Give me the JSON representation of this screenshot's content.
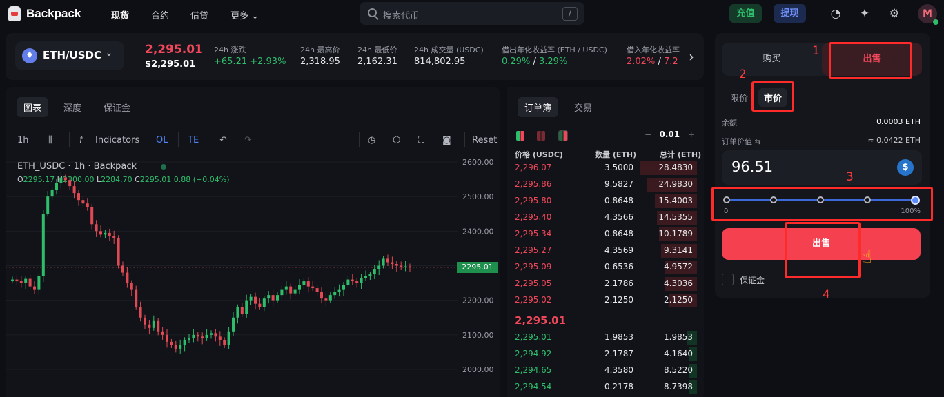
{
  "nav": {
    "logo": "Backpack",
    "items": [
      "现货",
      "合约",
      "借贷",
      "更多"
    ],
    "search_placeholder": "搜索代币",
    "search_shortcut": "/",
    "deposit": "充值",
    "withdraw": "提现",
    "avatar": "M"
  },
  "ticker": {
    "pair": "ETH/USDC",
    "last_price": "2,295.01",
    "last_price_usd": "$2,295.01",
    "stats": [
      {
        "label": "24h 涨跌",
        "value": "+65.21 +2.93%",
        "color": "#2ebd6b"
      },
      {
        "label": "24h 最高价",
        "value": "2,318.95",
        "color": "#ffffff"
      },
      {
        "label": "24h 最低价",
        "value": "2,162.31",
        "color": "#ffffff"
      },
      {
        "label": "24h 成交量 (USDC)",
        "value": "814,802.95",
        "color": "#ffffff"
      },
      {
        "label": "借出年化收益率 (ETH / USDC)",
        "value_a": "0.29%",
        "value_sep": " / ",
        "value_b": "3.29%",
        "color": "#2ebd6b"
      },
      {
        "label": "借入年化收益率",
        "value_a": "2.02%",
        "value_sep": " / ",
        "value_b": "7.2",
        "color": "#f0485a"
      }
    ]
  },
  "chart": {
    "tabs": [
      "图表",
      "深度",
      "保证金"
    ],
    "toolbar": {
      "interval": "1h",
      "indicators": "Indicators",
      "ol": "OL",
      "te": "TE",
      "reset": "Reset"
    },
    "symbol_line": "ETH_USDC · 1h · Backpack",
    "ohlc": {
      "o_k": "O",
      "o": "2295.17",
      "h_k": "H",
      "h": "2300.00",
      "l_k": "L",
      "l": "2284.70",
      "c_k": "C",
      "c": "2295.01",
      "chg": "0.88 (+0.04%)"
    },
    "price_tag": "2295.01"
  },
  "chart_data": {
    "type": "candlestick",
    "y_ticks": [
      "2600.00",
      "2500.00",
      "2400.00",
      "2300.00",
      "2200.00",
      "2100.00",
      "2000.00"
    ],
    "ylim": [
      1990,
      2640
    ],
    "last": 2295.01
  },
  "book": {
    "tabs": [
      "订单簿",
      "交易"
    ],
    "tick": "0.01",
    "minus": "−",
    "plus": "+",
    "headers": [
      "价格 (USDC)",
      "数量 (ETH)",
      "总计 (ETH)"
    ],
    "asks": [
      {
        "p": "2,296.07",
        "q": "3.5000",
        "t": "28.4830",
        "d": 0.3
      },
      {
        "p": "2,295.86",
        "q": "9.5827",
        "t": "24.9830",
        "d": 0.26
      },
      {
        "p": "2,295.80",
        "q": "0.8648",
        "t": "15.4003",
        "d": 0.22
      },
      {
        "p": "2,295.40",
        "q": "4.3566",
        "t": "14.5355",
        "d": 0.21
      },
      {
        "p": "2,295.34",
        "q": "0.8648",
        "t": "10.1789",
        "d": 0.2
      },
      {
        "p": "2,295.27",
        "q": "4.3569",
        "t": "9.3141",
        "d": 0.19
      },
      {
        "p": "2,295.09",
        "q": "0.6536",
        "t": "4.9572",
        "d": 0.17
      },
      {
        "p": "2,295.05",
        "q": "2.1786",
        "t": "4.3036",
        "d": 0.17
      },
      {
        "p": "2,295.02",
        "q": "2.1250",
        "t": "2.1250",
        "d": 0.15
      }
    ],
    "mid": "2,295.01",
    "bids": [
      {
        "p": "2,295.01",
        "q": "1.9853",
        "t": "1.9853",
        "d": 0.05
      },
      {
        "p": "2,294.92",
        "q": "2.1787",
        "t": "4.1640",
        "d": 0.04
      },
      {
        "p": "2,294.65",
        "q": "4.3580",
        "t": "8.5220",
        "d": 0.04
      },
      {
        "p": "2,294.54",
        "q": "0.2178",
        "t": "8.7398",
        "d": 0.04
      }
    ]
  },
  "trade": {
    "buy": "购买",
    "sell": "出售",
    "order_types": [
      "限价",
      "市价"
    ],
    "balance_label": "余额",
    "balance_value": "0.0003 ETH",
    "order_value_label": "订单价值",
    "order_value": "≈ 0.0422 ETH",
    "amount": "96.51",
    "slider_min": "0",
    "slider_max": "100%",
    "slider_value_pct": 100,
    "sell_button": "出售",
    "margin_label": "保证金"
  },
  "annotations": [
    "1",
    "2",
    "3",
    "4"
  ]
}
